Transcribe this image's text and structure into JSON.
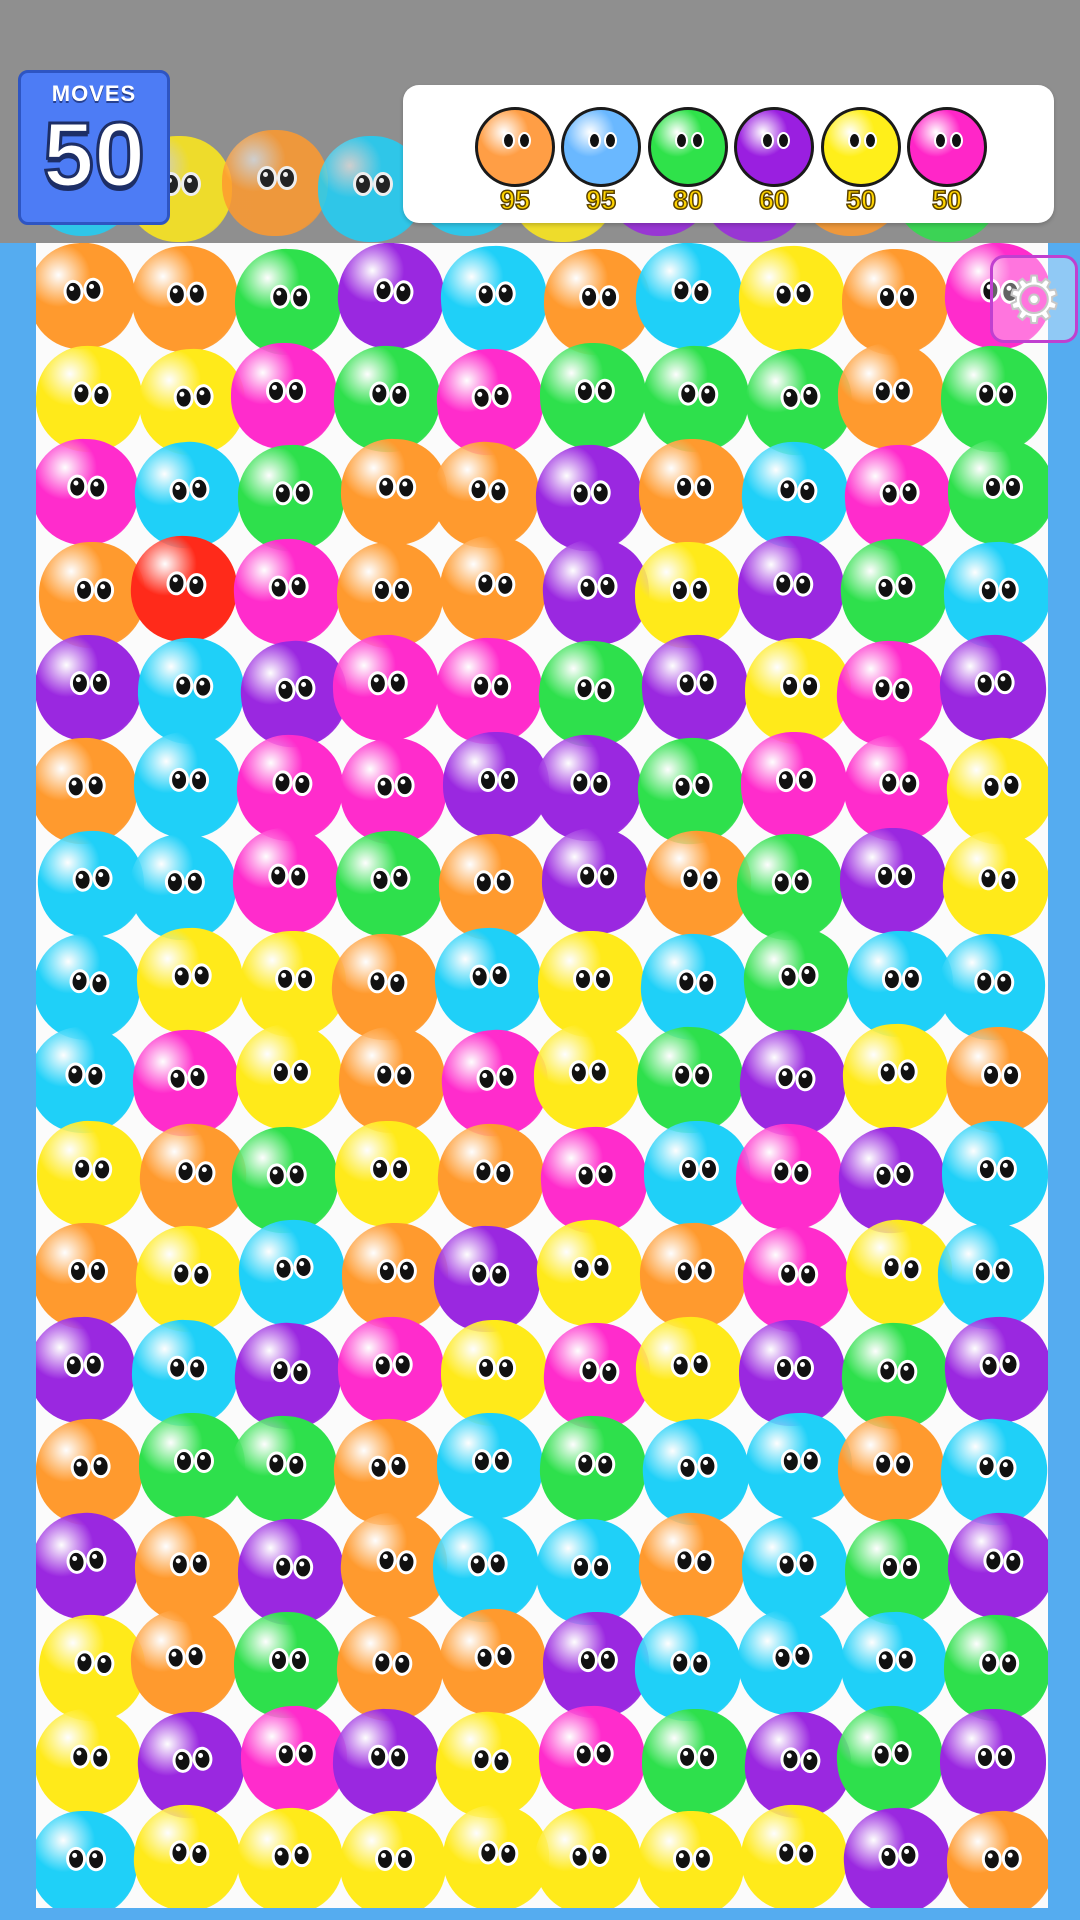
{
  "hud": {
    "moves_label": "MOVES",
    "moves_value": "50"
  },
  "goals": [
    {
      "color": "#ff9e45",
      "count": "95"
    },
    {
      "color": "#6ab8ff",
      "count": "95"
    },
    {
      "color": "#2fe24a",
      "count": "80"
    },
    {
      "color": "#9a1fe0",
      "count": "60"
    },
    {
      "color": "#ffef1a",
      "count": "50"
    },
    {
      "color": "#ff26c8",
      "count": "50"
    }
  ],
  "settings": {
    "icon": "gear-icon"
  },
  "palette": {
    "O": "#ff9a2e",
    "Y": "#ffea1a",
    "G": "#2ee04c",
    "P": "#9a28e0",
    "M": "#ff2ccc",
    "C": "#1fd0f8",
    "R": "#ff2a1a"
  },
  "board_rows": [
    "OOGPCOCYOM",
    "YYMGMGGGOG",
    "MCGOOPOCMG",
    "ORMOOPYPGC",
    "PCPMMGPYMP",
    "OCMMPPGMMY",
    "CCMGOPOGPY",
    "CYYOCYCGCC",
    "CMYOMYGPYO",
    "YOGYOMCMPC",
    "OYCOPYOMYC",
    "PCPMYMYPGP",
    "OGGOCGCCOC",
    "POPOCCOCGP",
    "YOGOOPCCCG",
    "YPMPYMGPGP",
    "CYYYYYYYPO"
  ],
  "peek_row": "CYOCCYPPOG"
}
